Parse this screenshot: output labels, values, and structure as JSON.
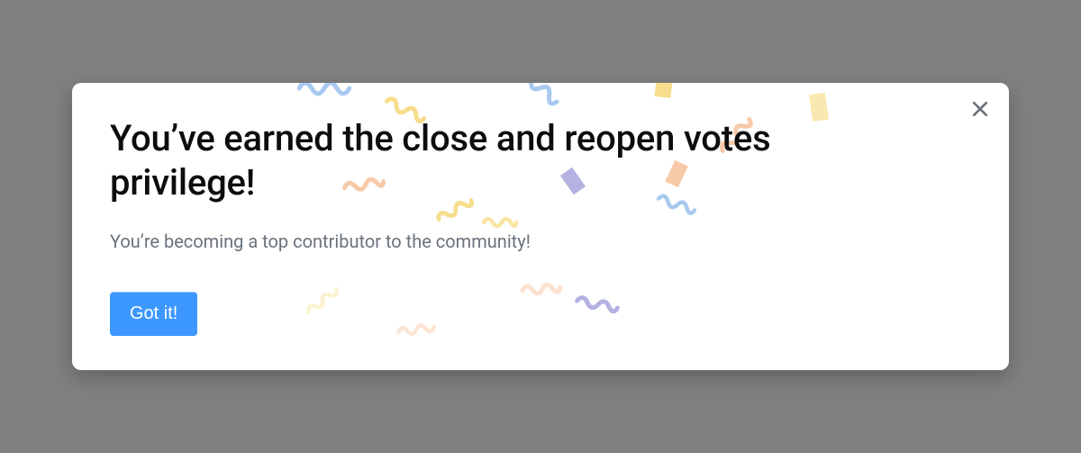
{
  "modal": {
    "title": "You’ve earned the close and reopen votes privilege!",
    "subtitle": "You’re becoming a top contributor to the community!",
    "primary_button_label": "Got it!"
  },
  "colors": {
    "button_bg": "#3c97ff",
    "text_primary": "#0c0d0e",
    "text_secondary": "#6a737c",
    "confetti_peach": "#f8c9a7",
    "confetti_blue": "#a9c9f0",
    "confetti_yellow": "#f6de8d",
    "confetti_lavender": "#b4b2e1"
  }
}
